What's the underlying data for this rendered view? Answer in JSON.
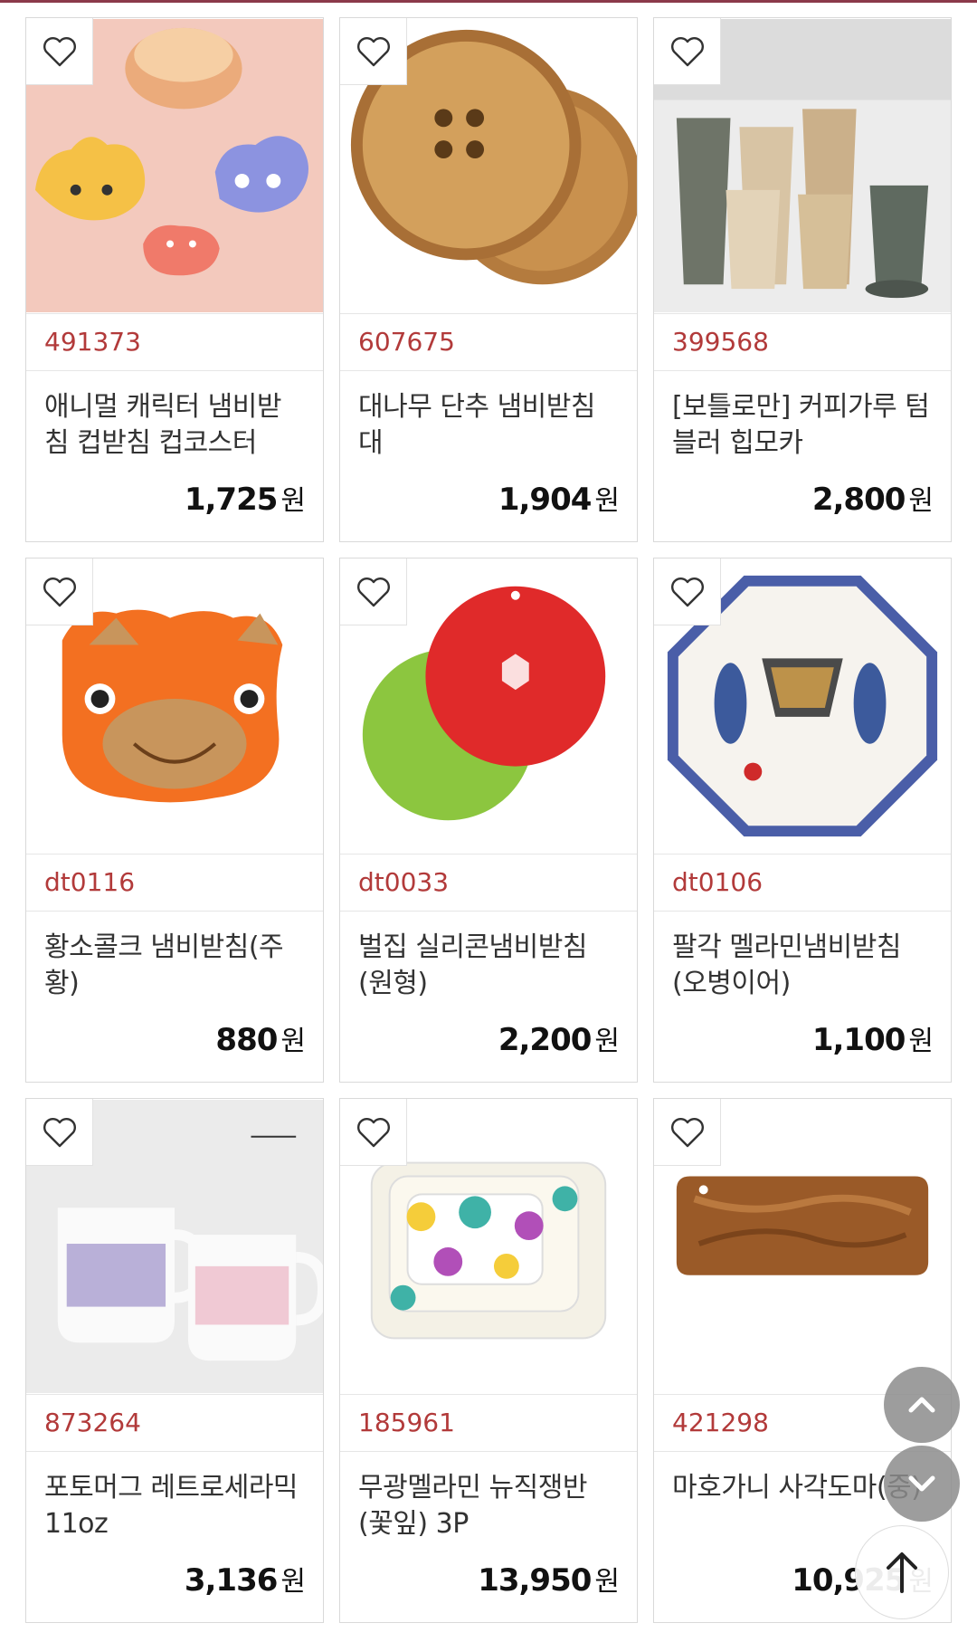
{
  "products": [
    {
      "code": "491373",
      "name": "애니멀 캐릭터 냄비받침 컵받침 컵코스터",
      "price": "1,725",
      "currency": "원"
    },
    {
      "code": "607675",
      "name": "대나무 단추 냄비받침대",
      "price": "1,904",
      "currency": "원"
    },
    {
      "code": "399568",
      "name": "[보틀로만] 커피가루 텀블러 힙모카",
      "price": "2,800",
      "currency": "원"
    },
    {
      "code": "dt0116",
      "name": "황소콜크 냄비받침(주황)",
      "price": "880",
      "currency": "원"
    },
    {
      "code": "dt0033",
      "name": "벌집 실리콘냄비받침(원형)",
      "price": "2,200",
      "currency": "원"
    },
    {
      "code": "dt0106",
      "name": "팔각 멜라민냄비받침(오병이어)",
      "price": "1,100",
      "currency": "원"
    },
    {
      "code": "873264",
      "name": "포토머그 레트로세라믹 11oz",
      "price": "3,136",
      "currency": "원"
    },
    {
      "code": "185961",
      "name": "무광멜라민 뉴직쟁반(꽃잎) 3P",
      "price": "13,950",
      "currency": "원"
    },
    {
      "code": "421298",
      "name": "마호가니 사각도마(중)",
      "price": "10,925",
      "currency": "원"
    }
  ],
  "icons": {
    "wishlist": "heart-outline-icon",
    "scroll_up": "chevron-up-icon",
    "scroll_down": "chevron-down-icon",
    "back_to_top": "arrow-up-icon"
  },
  "colors": {
    "product_code": "#b23a3a",
    "top_border": "#8b3a4a",
    "fab": "#8c8c8c"
  }
}
